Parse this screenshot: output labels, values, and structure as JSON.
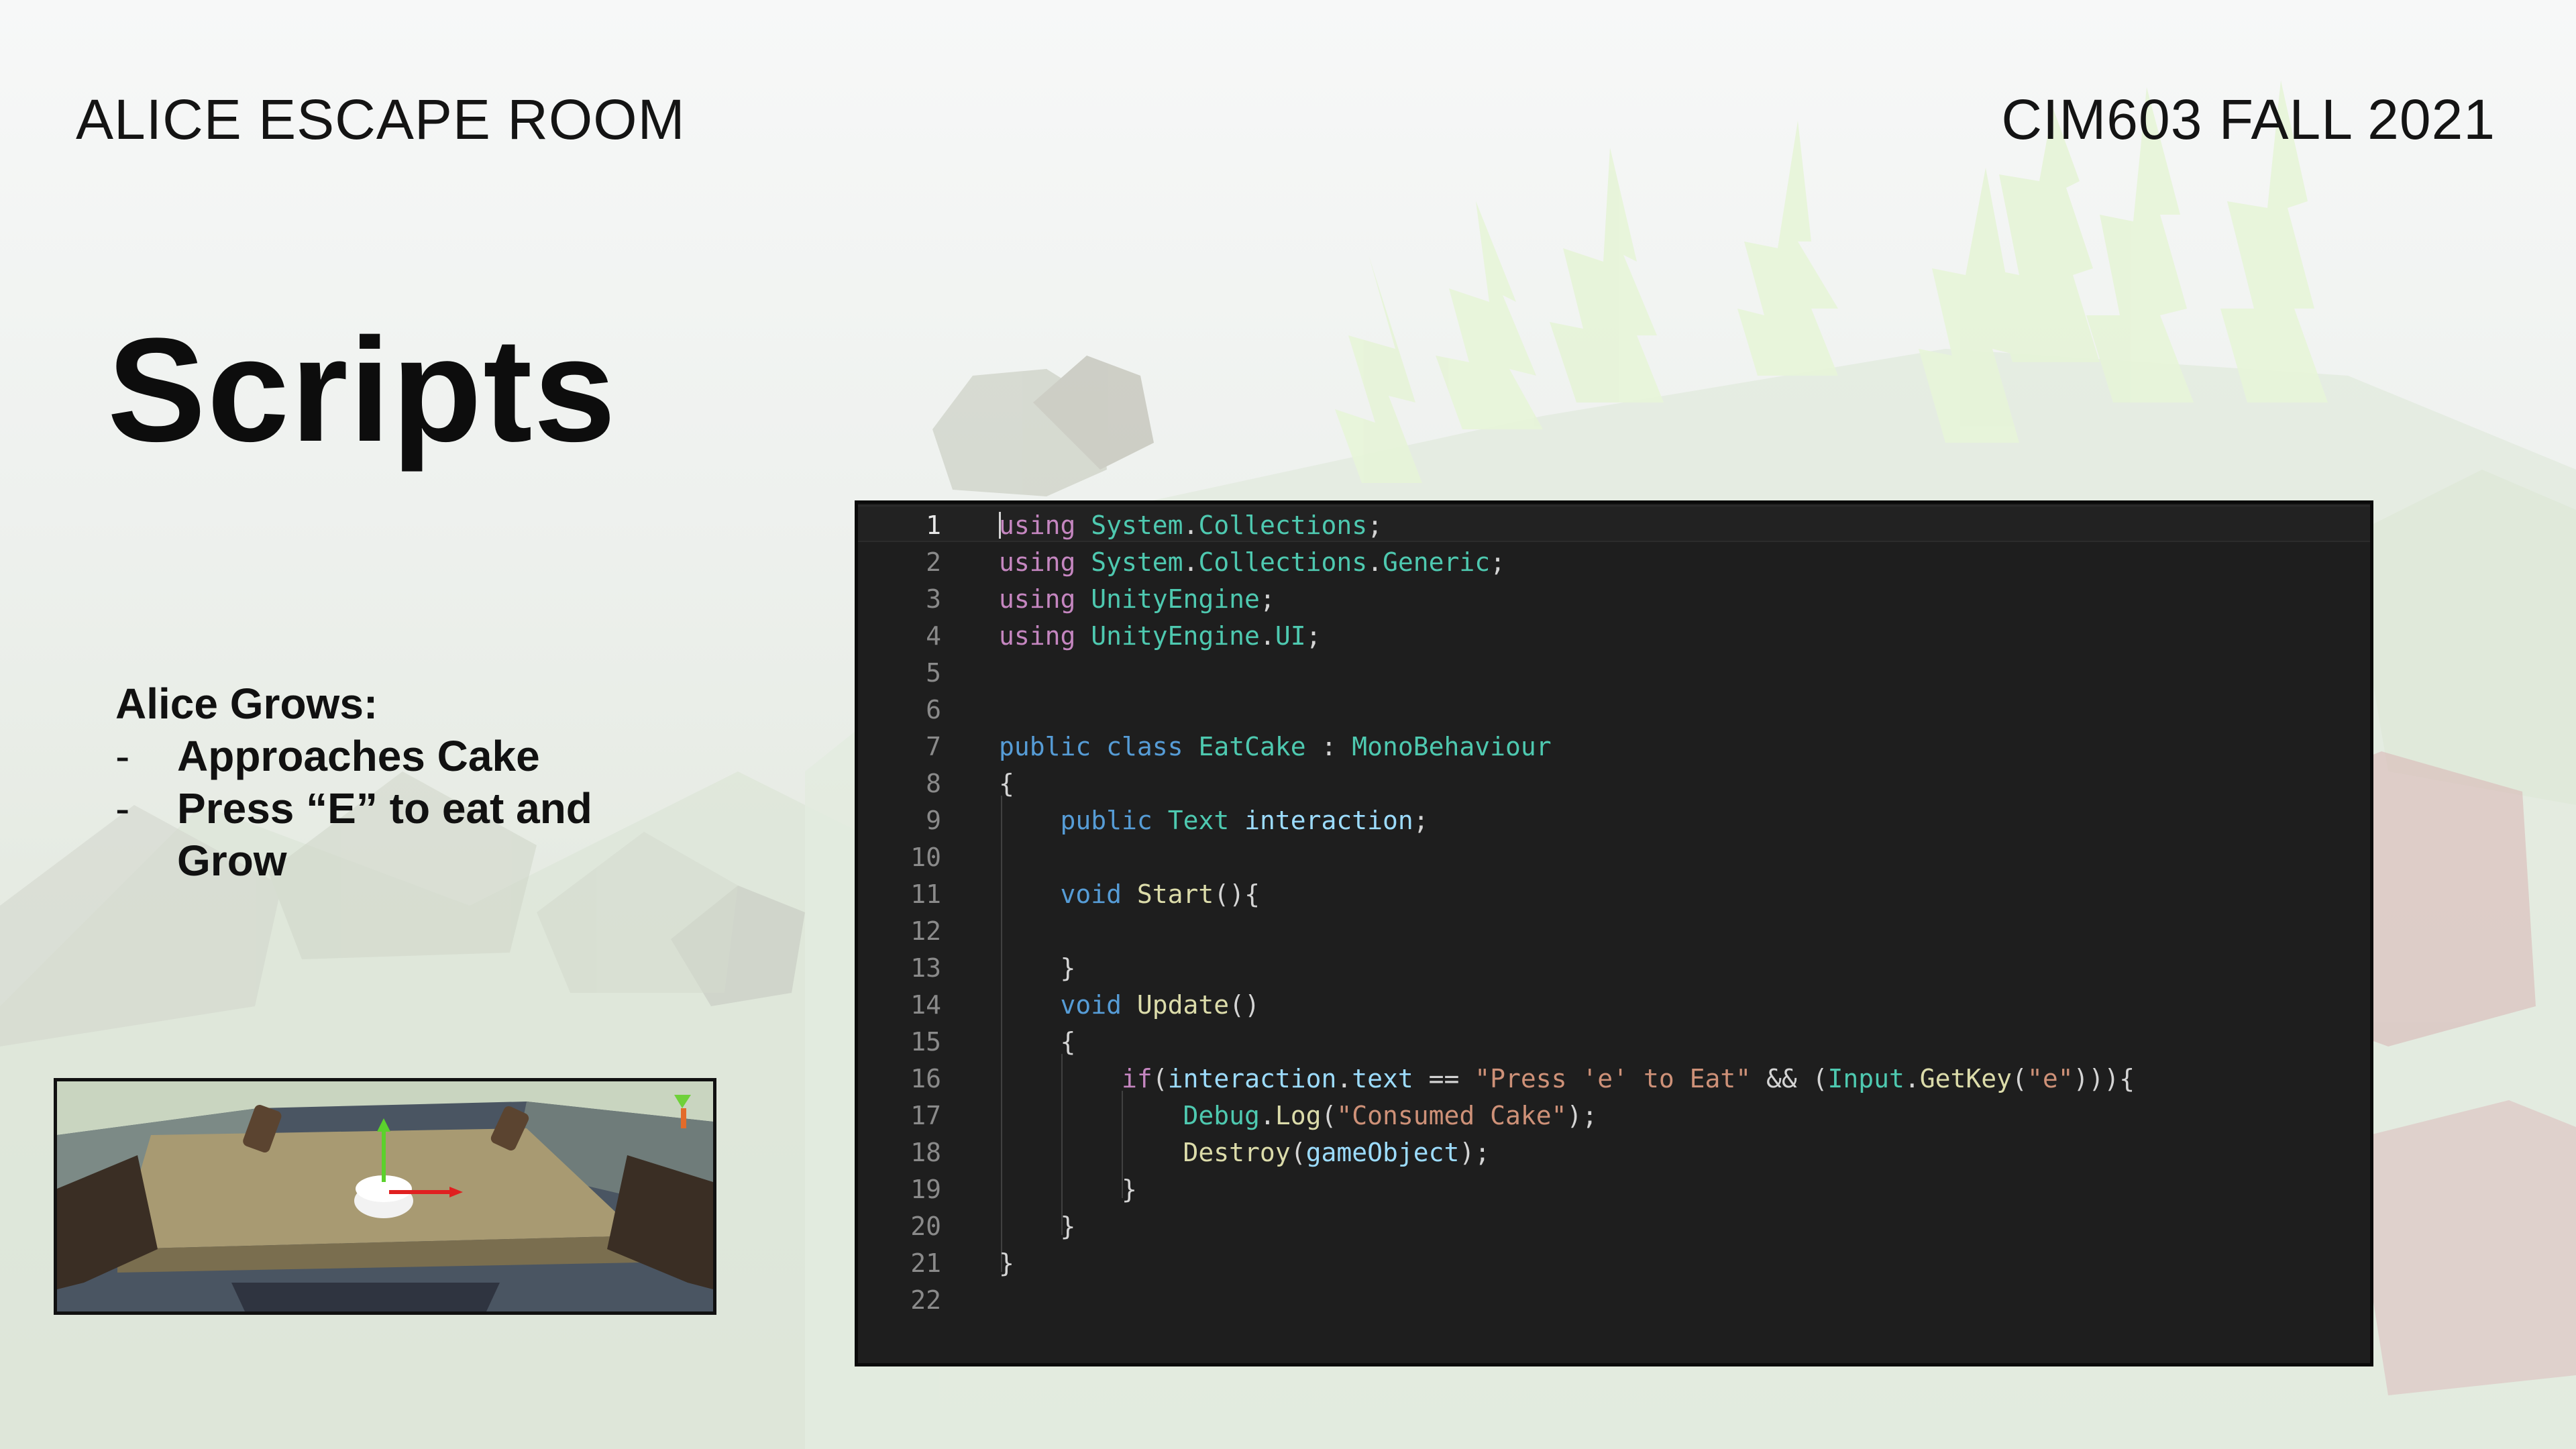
{
  "slide": {
    "header_left": "ALICE ESCAPE ROOM",
    "header_right": "CIM603 FALL 2021",
    "title": "Scripts",
    "bullets": {
      "heading": "Alice Grows:",
      "items": [
        "Approaches Cake",
        "Press “E” to eat and Grow"
      ],
      "dash": "-"
    }
  },
  "editor": {
    "current_line": 1,
    "lines": [
      {
        "n": "1",
        "tokens": [
          [
            "kw",
            "using"
          ],
          [
            "pl",
            " "
          ],
          [
            "ty",
            "System"
          ],
          [
            "pl",
            "."
          ],
          [
            "ty",
            "Collections"
          ],
          [
            "pl",
            ";"
          ]
        ]
      },
      {
        "n": "2",
        "tokens": [
          [
            "kw",
            "using"
          ],
          [
            "pl",
            " "
          ],
          [
            "ty",
            "System"
          ],
          [
            "pl",
            "."
          ],
          [
            "ty",
            "Collections"
          ],
          [
            "pl",
            "."
          ],
          [
            "ty",
            "Generic"
          ],
          [
            "pl",
            ";"
          ]
        ]
      },
      {
        "n": "3",
        "tokens": [
          [
            "kw",
            "using"
          ],
          [
            "pl",
            " "
          ],
          [
            "ty",
            "UnityEngine"
          ],
          [
            "pl",
            ";"
          ]
        ]
      },
      {
        "n": "4",
        "tokens": [
          [
            "kw",
            "using"
          ],
          [
            "pl",
            " "
          ],
          [
            "ty",
            "UnityEngine"
          ],
          [
            "pl",
            "."
          ],
          [
            "ty",
            "UI"
          ],
          [
            "pl",
            ";"
          ]
        ]
      },
      {
        "n": "5",
        "tokens": []
      },
      {
        "n": "6",
        "tokens": []
      },
      {
        "n": "7",
        "tokens": [
          [
            "kwb",
            "public"
          ],
          [
            "pl",
            " "
          ],
          [
            "kwb",
            "class"
          ],
          [
            "pl",
            " "
          ],
          [
            "ty",
            "EatCake"
          ],
          [
            "pl",
            " : "
          ],
          [
            "ty",
            "MonoBehaviour"
          ]
        ]
      },
      {
        "n": "8",
        "tokens": [
          [
            "pl",
            "{"
          ]
        ]
      },
      {
        "n": "9",
        "tokens": [
          [
            "pl",
            "    "
          ],
          [
            "kwb",
            "public"
          ],
          [
            "pl",
            " "
          ],
          [
            "ty",
            "Text"
          ],
          [
            "pl",
            " "
          ],
          [
            "vr",
            "interaction"
          ],
          [
            "pl",
            ";"
          ]
        ]
      },
      {
        "n": "10",
        "tokens": []
      },
      {
        "n": "11",
        "tokens": [
          [
            "pl",
            "    "
          ],
          [
            "kwb",
            "void"
          ],
          [
            "pl",
            " "
          ],
          [
            "fn",
            "Start"
          ],
          [
            "pl",
            "(){"
          ]
        ]
      },
      {
        "n": "12",
        "tokens": []
      },
      {
        "n": "13",
        "tokens": [
          [
            "pl",
            "    }"
          ]
        ]
      },
      {
        "n": "14",
        "tokens": [
          [
            "pl",
            "    "
          ],
          [
            "kwb",
            "void"
          ],
          [
            "pl",
            " "
          ],
          [
            "fn",
            "Update"
          ],
          [
            "pl",
            "()"
          ]
        ]
      },
      {
        "n": "15",
        "tokens": [
          [
            "pl",
            "    {"
          ]
        ]
      },
      {
        "n": "16",
        "tokens": [
          [
            "pl",
            "        "
          ],
          [
            "kw",
            "if"
          ],
          [
            "pl",
            "("
          ],
          [
            "vr",
            "interaction"
          ],
          [
            "pl",
            "."
          ],
          [
            "vr",
            "text"
          ],
          [
            "pl",
            " == "
          ],
          [
            "st",
            "\"Press 'e' to Eat\""
          ],
          [
            "pl",
            " && ("
          ],
          [
            "ty",
            "Input"
          ],
          [
            "pl",
            "."
          ],
          [
            "fn",
            "GetKey"
          ],
          [
            "pl",
            "("
          ],
          [
            "st",
            "\"e\""
          ],
          [
            "pl",
            ")))"
          ],
          [
            "pl",
            "{"
          ]
        ]
      },
      {
        "n": "17",
        "tokens": [
          [
            "pl",
            "            "
          ],
          [
            "ty",
            "Debug"
          ],
          [
            "pl",
            "."
          ],
          [
            "fn",
            "Log"
          ],
          [
            "pl",
            "("
          ],
          [
            "st",
            "\"Consumed Cake\""
          ],
          [
            "pl",
            ");"
          ]
        ]
      },
      {
        "n": "18",
        "tokens": [
          [
            "pl",
            "            "
          ],
          [
            "fn",
            "Destroy"
          ],
          [
            "pl",
            "("
          ],
          [
            "vr",
            "gameObject"
          ],
          [
            "pl",
            ");"
          ]
        ]
      },
      {
        "n": "19",
        "tokens": [
          [
            "pl",
            "        }"
          ]
        ]
      },
      {
        "n": "20",
        "tokens": [
          [
            "pl",
            "    }"
          ]
        ]
      },
      {
        "n": "21",
        "tokens": [
          [
            "pl",
            "}"
          ]
        ]
      },
      {
        "n": "22",
        "tokens": []
      }
    ]
  },
  "thumbnail": {
    "icon": "cake-scene-preview"
  }
}
